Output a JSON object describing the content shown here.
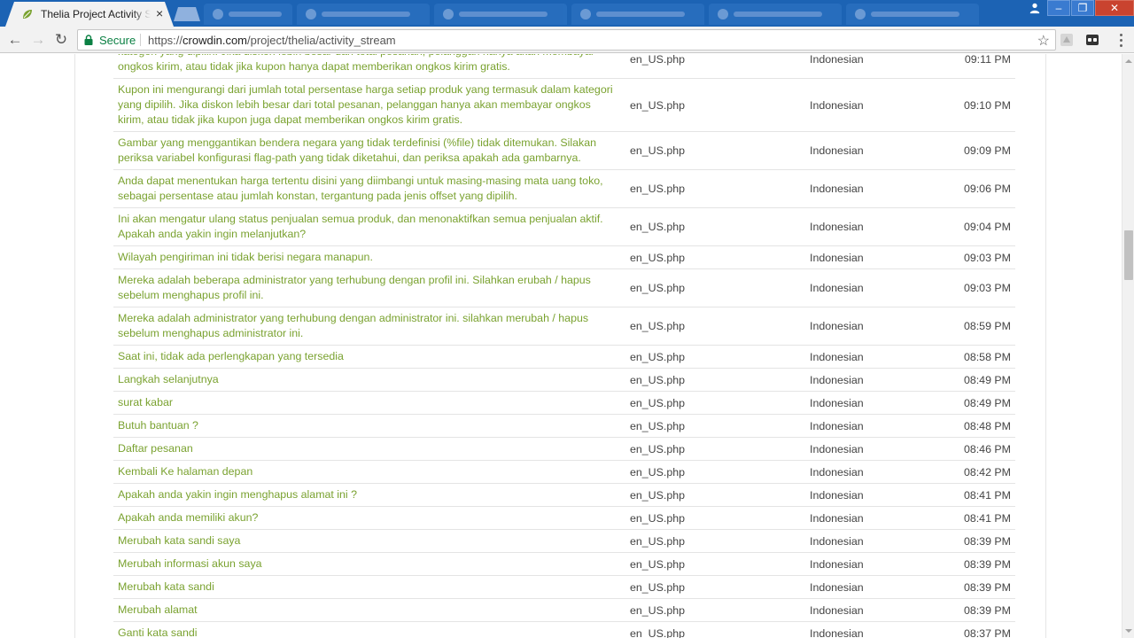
{
  "browser": {
    "active_tab": {
      "title": "Thelia Project Activity Stream",
      "close": "×"
    },
    "background_tabs": 6,
    "window_controls": {
      "minimize": "–",
      "maximize": "❐",
      "close": "✕"
    },
    "nav": {
      "back": "←",
      "forward": "→",
      "reload": "↻"
    },
    "security_label": "Secure",
    "url": {
      "scheme": "https://",
      "host": "crowdin.com",
      "path": "/project/thelia/activity_stream"
    },
    "bookmark": "☆"
  },
  "rows": [
    {
      "message": "kategori yang dipilih. Jika diskon lebih besar dari total pesanan, pelanggan hanya akan membayar ongkos kirim, atau tidak jika kupon hanya dapat memberikan ongkos kirim gratis.",
      "file": "en_US.php",
      "language": "Indonesian",
      "time": "09:11 PM",
      "lines": 2
    },
    {
      "message": "Kupon ini mengurangi dari jumlah total persentase harga setiap produk yang termasuk dalam kategori yang dipilih. Jika diskon lebih besar dari total pesanan, pelanggan hanya akan membayar ongkos kirim, atau tidak jika kupon juga dapat memberikan ongkos kirim gratis.",
      "file": "en_US.php",
      "language": "Indonesian",
      "time": "09:10 PM",
      "lines": 3
    },
    {
      "message": "Gambar yang menggantikan bendera negara yang tidak terdefinisi (%file) tidak ditemukan. Silakan periksa variabel konfigurasi flag-path yang tidak diketahui, dan periksa apakah ada gambarnya.",
      "file": "en_US.php",
      "language": "Indonesian",
      "time": "09:09 PM",
      "lines": 2
    },
    {
      "message": "Anda dapat menentukan harga tertentu disini yang diimbangi untuk masing-masing mata uang toko, sebagai persentase atau jumlah konstan, tergantung pada jenis offset yang dipilih.",
      "file": "en_US.php",
      "language": "Indonesian",
      "time": "09:06 PM",
      "lines": 2
    },
    {
      "message": "Ini akan mengatur ulang status penjualan semua produk, dan menonaktifkan semua penjualan aktif. Apakah anda yakin ingin melanjutkan?",
      "file": "en_US.php",
      "language": "Indonesian",
      "time": "09:04 PM",
      "lines": 2
    },
    {
      "message": "Wilayah pengiriman ini tidak berisi negara manapun.",
      "file": "en_US.php",
      "language": "Indonesian",
      "time": "09:03 PM",
      "lines": 1
    },
    {
      "message": "Mereka adalah beberapa administrator yang terhubung dengan profil ini. Silahkan erubah / hapus sebelum menghapus profil ini.",
      "file": "en_US.php",
      "language": "Indonesian",
      "time": "09:03 PM",
      "lines": 2
    },
    {
      "message": "Mereka adalah administrator yang terhubung dengan administrator ini. silahkan merubah / hapus sebelum menghapus administrator ini.",
      "file": "en_US.php",
      "language": "Indonesian",
      "time": "08:59 PM",
      "lines": 2
    },
    {
      "message": "Saat ini, tidak ada perlengkapan yang tersedia",
      "file": "en_US.php",
      "language": "Indonesian",
      "time": "08:58 PM",
      "lines": 1
    },
    {
      "message": "Langkah selanjutnya",
      "file": "en_US.php",
      "language": "Indonesian",
      "time": "08:49 PM",
      "lines": 1
    },
    {
      "message": "surat kabar",
      "file": "en_US.php",
      "language": "Indonesian",
      "time": "08:49 PM",
      "lines": 1
    },
    {
      "message": "Butuh bantuan ?",
      "file": "en_US.php",
      "language": "Indonesian",
      "time": "08:48 PM",
      "lines": 1
    },
    {
      "message": "Daftar pesanan",
      "file": "en_US.php",
      "language": "Indonesian",
      "time": "08:46 PM",
      "lines": 1
    },
    {
      "message": "Kembali Ke halaman depan",
      "file": "en_US.php",
      "language": "Indonesian",
      "time": "08:42 PM",
      "lines": 1
    },
    {
      "message": "Apakah anda yakin ingin menghapus alamat ini ?",
      "file": "en_US.php",
      "language": "Indonesian",
      "time": "08:41 PM",
      "lines": 1
    },
    {
      "message": "Apakah anda memiliki akun?",
      "file": "en_US.php",
      "language": "Indonesian",
      "time": "08:41 PM",
      "lines": 1
    },
    {
      "message": "Merubah kata sandi saya",
      "file": "en_US.php",
      "language": "Indonesian",
      "time": "08:39 PM",
      "lines": 1
    },
    {
      "message": "Merubah informasi akun saya",
      "file": "en_US.php",
      "language": "Indonesian",
      "time": "08:39 PM",
      "lines": 1
    },
    {
      "message": "Merubah kata sandi",
      "file": "en_US.php",
      "language": "Indonesian",
      "time": "08:39 PM",
      "lines": 1
    },
    {
      "message": "Merubah alamat",
      "file": "en_US.php",
      "language": "Indonesian",
      "time": "08:39 PM",
      "lines": 1
    },
    {
      "message": "Ganti kata sandi",
      "file": "en_US.php",
      "language": "Indonesian",
      "time": "08:37 PM",
      "lines": 1
    }
  ],
  "colors": {
    "link_green": "#7aa230",
    "tab_strip_blue": "#1c63b4",
    "secure_green": "#0b8043"
  },
  "icons": {
    "favicon": "crowdin-leaf-icon",
    "lock": "lock-icon",
    "bookmark": "star-icon",
    "menu": "kebab-menu-icon"
  }
}
